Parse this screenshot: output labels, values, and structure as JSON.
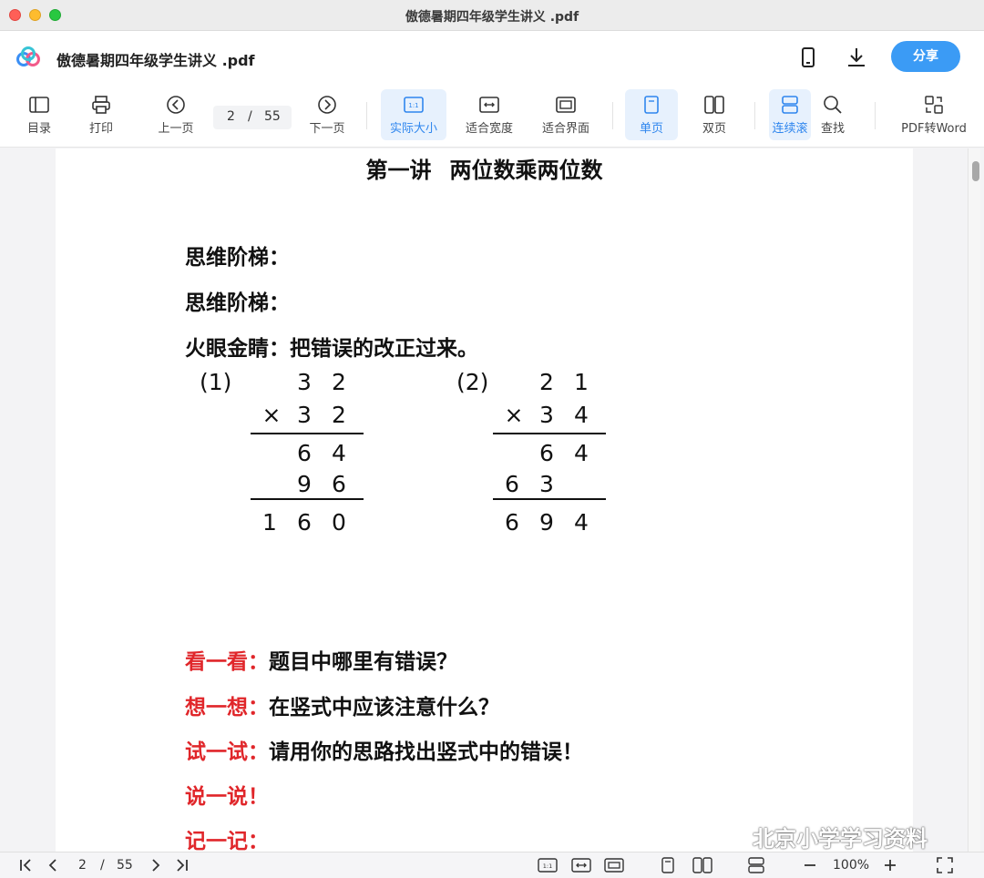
{
  "window": {
    "title": "傲德暑期四年级学生讲义 .pdf"
  },
  "header": {
    "doc_title": "傲德暑期四年级学生讲义 .pdf",
    "share_label": "分享"
  },
  "toolbar": {
    "toc": "目录",
    "print": "打印",
    "prev": "上一页",
    "page_current": "2",
    "page_sep": "/",
    "page_total": "55",
    "next": "下一页",
    "actual_size": "实际大小",
    "fit_width": "适合宽度",
    "fit_page": "适合界面",
    "single_page": "单页",
    "double_page": "双页",
    "continuous": "连续滚",
    "find": "查找",
    "pdf_to_word": "PDF转Word",
    "accent": "#2f86ee"
  },
  "document": {
    "title_a": "第一讲",
    "title_b": "两位数乘两位数",
    "line1": "思维阶梯：",
    "line2": "思维阶梯：",
    "line3": "火眼金睛：把错误的改正过来。",
    "problem1": {
      "label": "(1)",
      "row1": [
        "3",
        "2"
      ],
      "mult": "×",
      "row2": [
        "3",
        "2"
      ],
      "p1": [
        "6",
        "4"
      ],
      "p2": [
        "9",
        "6"
      ],
      "result": [
        "1",
        "6",
        "0"
      ]
    },
    "problem2": {
      "label": "(2)",
      "row1": [
        "2",
        "1"
      ],
      "mult": "×",
      "row2": [
        "3",
        "4"
      ],
      "p1": [
        "6",
        "4"
      ],
      "p2": [
        "6",
        "3"
      ],
      "result": [
        "6",
        "9",
        "4"
      ]
    },
    "look_red": "看一看：",
    "look_black": "题目中哪里有错误？",
    "think_red": "想一想：",
    "think_black": "在竖式中应该注意什么？",
    "try_red": "试一试：",
    "try_black": "请用你的思路找出竖式中的错误！",
    "say_red": "说一说！",
    "note_red": "记一记：",
    "watermark": "北京小学学习资料"
  },
  "bottombar": {
    "page_current": "2",
    "page_sep": "/",
    "page_total": "55",
    "zoom": "100%"
  }
}
